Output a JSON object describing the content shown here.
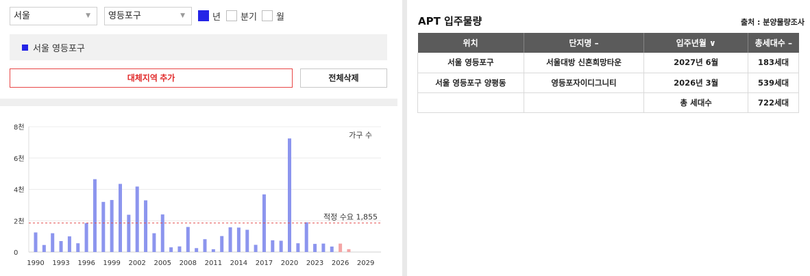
{
  "filters": {
    "region": "서울",
    "district": "영등포구",
    "period_options": [
      {
        "label": "년",
        "checked": true
      },
      {
        "label": "분기",
        "checked": false
      },
      {
        "label": "월",
        "checked": false
      }
    ]
  },
  "selected_area": {
    "label": "서울 영등포구",
    "color": "#2424e6"
  },
  "actions": {
    "add_label": "대체지역 추가",
    "clear_label": "전체삭제"
  },
  "chart_data": {
    "type": "bar",
    "legend_label": "가구 수",
    "ylim": [
      0,
      8000
    ],
    "y_ticks": [
      {
        "value": 0,
        "label": "0"
      },
      {
        "value": 2000,
        "label": "2천"
      },
      {
        "value": 4000,
        "label": "4천"
      },
      {
        "value": 6000,
        "label": "6천"
      },
      {
        "value": 8000,
        "label": "8천"
      }
    ],
    "x_ticks": [
      "1990",
      "1993",
      "1996",
      "1999",
      "2002",
      "2005",
      "2008",
      "2011",
      "2014",
      "2017",
      "2020",
      "2023",
      "2026",
      "2029"
    ],
    "reference_line": {
      "value": 1855,
      "label": "적정 수요 1,855"
    },
    "bar_color": "#8c95ee",
    "future_bar_color": "#f4a5a5",
    "grid": true,
    "bars": [
      {
        "year": 1990,
        "value": 1250
      },
      {
        "year": 1991,
        "value": 450
      },
      {
        "year": 1992,
        "value": 1200
      },
      {
        "year": 1993,
        "value": 700
      },
      {
        "year": 1994,
        "value": 1000
      },
      {
        "year": 1995,
        "value": 560
      },
      {
        "year": 1996,
        "value": 1850
      },
      {
        "year": 1997,
        "value": 4650
      },
      {
        "year": 1998,
        "value": 3200
      },
      {
        "year": 1999,
        "value": 3320
      },
      {
        "year": 2000,
        "value": 4350
      },
      {
        "year": 2001,
        "value": 2380
      },
      {
        "year": 2002,
        "value": 4180
      },
      {
        "year": 2003,
        "value": 3300
      },
      {
        "year": 2004,
        "value": 1200
      },
      {
        "year": 2005,
        "value": 2400
      },
      {
        "year": 2006,
        "value": 300
      },
      {
        "year": 2007,
        "value": 360
      },
      {
        "year": 2008,
        "value": 1600
      },
      {
        "year": 2009,
        "value": 250
      },
      {
        "year": 2010,
        "value": 820
      },
      {
        "year": 2011,
        "value": 180
      },
      {
        "year": 2012,
        "value": 1020
      },
      {
        "year": 2013,
        "value": 1580
      },
      {
        "year": 2014,
        "value": 1560
      },
      {
        "year": 2015,
        "value": 1420
      },
      {
        "year": 2016,
        "value": 460
      },
      {
        "year": 2017,
        "value": 3680
      },
      {
        "year": 2018,
        "value": 750
      },
      {
        "year": 2019,
        "value": 720
      },
      {
        "year": 2020,
        "value": 7250
      },
      {
        "year": 2021,
        "value": 560
      },
      {
        "year": 2022,
        "value": 1900
      },
      {
        "year": 2023,
        "value": 520
      },
      {
        "year": 2024,
        "value": 540
      },
      {
        "year": 2025,
        "value": 350
      },
      {
        "year": 2026,
        "value": 539,
        "future": true
      },
      {
        "year": 2027,
        "value": 183,
        "future": true
      }
    ]
  },
  "apt": {
    "title": "APT 입주물량",
    "source": "출처 : 분양물량조사",
    "columns": [
      "위치",
      "단지명 –",
      "입주년월 ∨",
      "총세대수 –"
    ],
    "rows": [
      [
        "서울 영등포구",
        "서울대방 신혼희망타운",
        "2027년 6월",
        "183세대"
      ],
      [
        "서울 영등포구 양평동",
        "영등포자이디그니티",
        "2026년 3월",
        "539세대"
      ]
    ],
    "total": {
      "label": "총 세대수",
      "value": "722세대"
    }
  }
}
